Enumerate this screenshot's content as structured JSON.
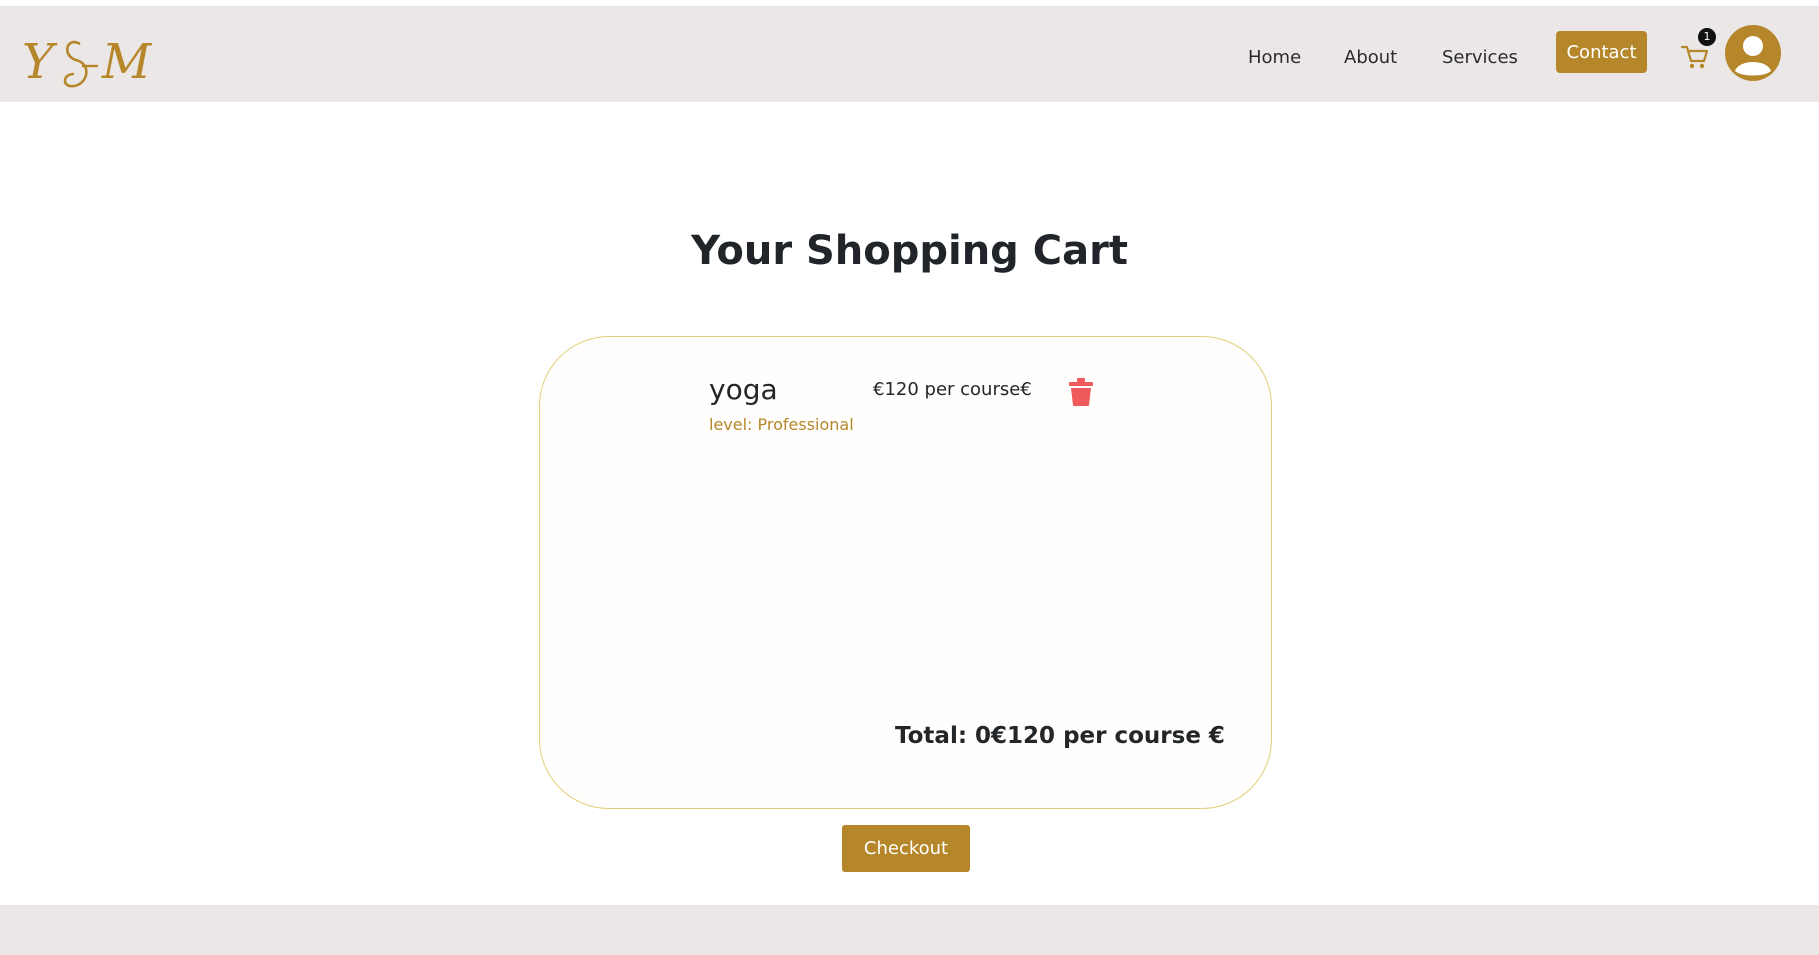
{
  "brand": {
    "logo_text": "Y&M",
    "accent_color": "#b5872a"
  },
  "nav": {
    "links": [
      "Home",
      "About",
      "Services"
    ],
    "contact_label": "Contact",
    "cart_count": "1",
    "cart_icon": "shopping-cart-icon",
    "avatar_icon": "user-avatar-icon"
  },
  "page": {
    "title": "Your Shopping Cart"
  },
  "cart": {
    "items": [
      {
        "name": "yoga",
        "level": "level: Professional",
        "price": "€120 per course€",
        "remove_icon": "trash-icon"
      }
    ],
    "total": "Total: 0€120 per course €",
    "checkout_label": "Checkout"
  },
  "colors": {
    "navbar_bg": "#ebe7e7",
    "card_border": "#e3cf7a",
    "trash": "#f05a5a"
  }
}
